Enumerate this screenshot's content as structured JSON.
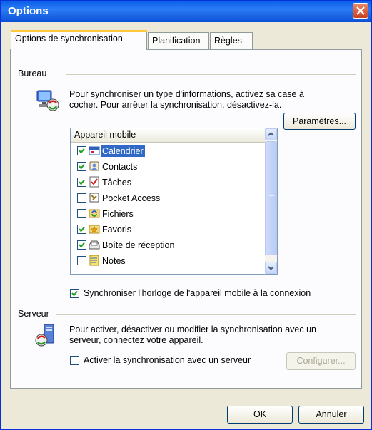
{
  "window": {
    "title": "Options"
  },
  "tabs": [
    {
      "label": "Options de synchronisation",
      "active": true
    },
    {
      "label": "Planification",
      "active": false
    },
    {
      "label": "Règles",
      "active": false
    }
  ],
  "bureau": {
    "group_label": "Bureau",
    "description": [
      "Pour synchroniser un type d'informations, activez sa case à",
      "cocher. Pour arrêter la synchronisation, désactivez-la."
    ],
    "list_header": "Appareil mobile",
    "items": [
      {
        "label": "Calendrier",
        "checked": true,
        "selected": true,
        "icon": "calendar-icon"
      },
      {
        "label": "Contacts",
        "checked": true,
        "selected": false,
        "icon": "contacts-icon"
      },
      {
        "label": "Tâches",
        "checked": true,
        "selected": false,
        "icon": "tasks-icon"
      },
      {
        "label": "Pocket Access",
        "checked": false,
        "selected": false,
        "icon": "pocket-access-icon"
      },
      {
        "label": "Fichiers",
        "checked": false,
        "selected": false,
        "icon": "files-icon"
      },
      {
        "label": "Favoris",
        "checked": true,
        "selected": false,
        "icon": "favorites-icon"
      },
      {
        "label": "Boîte de réception",
        "checked": true,
        "selected": false,
        "icon": "inbox-icon"
      },
      {
        "label": "Notes",
        "checked": false,
        "selected": false,
        "icon": "notes-icon"
      }
    ],
    "settings_button": "Paramètres...",
    "sync_clock_label": "Synchroniser l'horloge de l'appareil mobile à la connexion",
    "sync_clock_checked": true
  },
  "serveur": {
    "group_label": "Serveur",
    "description": [
      "Pour activer, désactiver ou modifier la synchronisation avec un",
      "serveur, connectez votre appareil."
    ],
    "enable_label": "Activer la synchronisation avec un serveur",
    "enable_checked": false,
    "configure_button": "Configurer..."
  },
  "footer": {
    "ok_button": "OK",
    "cancel_button": "Annuler"
  },
  "colors": {
    "title_bar": "#0a5fe8",
    "selection": "#316ac5",
    "dialog_bg": "#ece9d8",
    "close_button": "#c8401e"
  }
}
